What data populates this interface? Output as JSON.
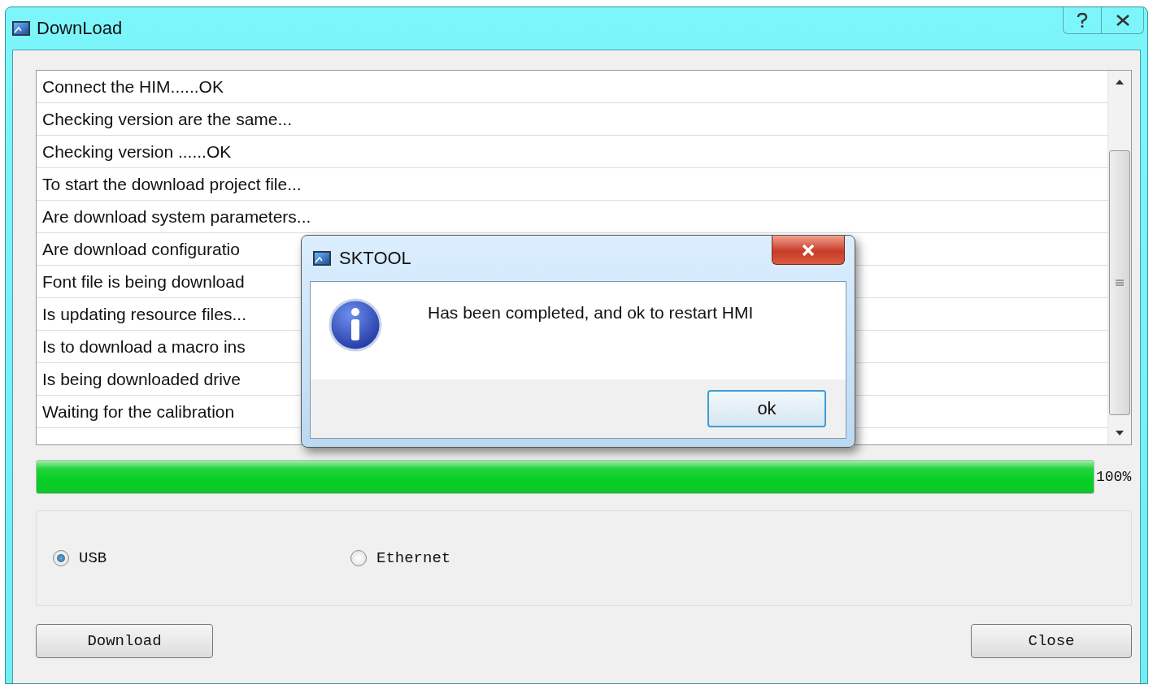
{
  "window": {
    "title": "DownLoad"
  },
  "log_lines": [
    "Connect the HIM......OK",
    "Checking version are the same...",
    "Checking version ......OK",
    "To start the download project file...",
    "Are download system parameters...",
    "Are download configuratio",
    "Font file is being download",
    "Is updating resource files...",
    "Is to download a macro ins",
    "Is being downloaded drive",
    "Waiting for the calibration"
  ],
  "progress": {
    "level": 1,
    "reading": "100%"
  },
  "connection_options": [
    {
      "label": "USB",
      "selected": true
    },
    {
      "label": "Ethernet",
      "selected": false
    }
  ],
  "buttons": [
    "Download",
    "Close"
  ],
  "dialog": {
    "title": "SKTOOL",
    "message": "Has been completed, and ok to restart HMI",
    "button": "ok"
  }
}
